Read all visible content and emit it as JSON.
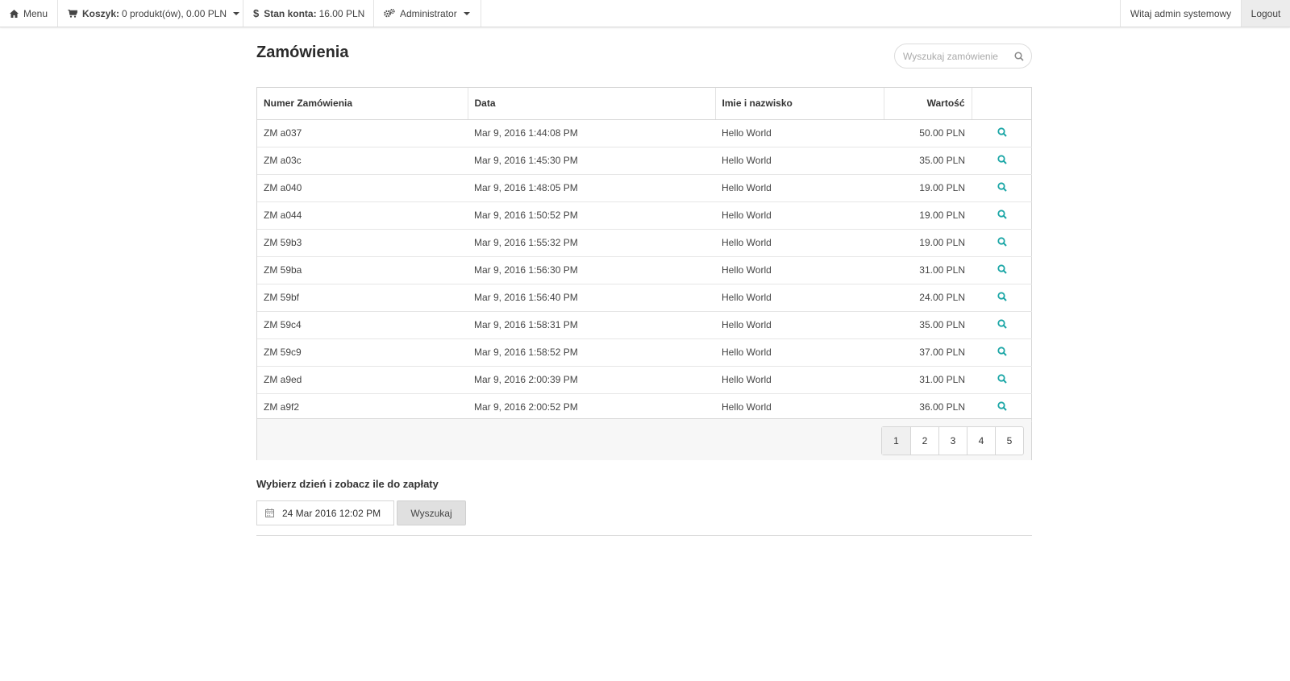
{
  "topbar": {
    "menu_label": "Menu",
    "cart_label": "Koszyk:",
    "cart_value": "0 produkt(ów), 0.00 PLN",
    "balance_label": "Stan konta:",
    "balance_value": "16.00 PLN",
    "admin_label": "Administrator",
    "welcome": "Witaj admin systemowy",
    "logout": "Logout"
  },
  "page": {
    "title": "Zamówienia",
    "search_placeholder": "Wyszukaj zamówienie"
  },
  "table": {
    "headers": [
      "Numer Zamówienia",
      "Data",
      "Imie i nazwisko",
      "Wartość"
    ],
    "rows": [
      [
        "ZM a037",
        "Mar 9, 2016 1:44:08 PM",
        "Hello World",
        "50.00 PLN"
      ],
      [
        "ZM a03c",
        "Mar 9, 2016 1:45:30 PM",
        "Hello World",
        "35.00 PLN"
      ],
      [
        "ZM a040",
        "Mar 9, 2016 1:48:05 PM",
        "Hello World",
        "19.00 PLN"
      ],
      [
        "ZM a044",
        "Mar 9, 2016 1:50:52 PM",
        "Hello World",
        "19.00 PLN"
      ],
      [
        "ZM 59b3",
        "Mar 9, 2016 1:55:32 PM",
        "Hello World",
        "19.00 PLN"
      ],
      [
        "ZM 59ba",
        "Mar 9, 2016 1:56:30 PM",
        "Hello World",
        "31.00 PLN"
      ],
      [
        "ZM 59bf",
        "Mar 9, 2016 1:56:40 PM",
        "Hello World",
        "24.00 PLN"
      ],
      [
        "ZM 59c4",
        "Mar 9, 2016 1:58:31 PM",
        "Hello World",
        "35.00 PLN"
      ],
      [
        "ZM 59c9",
        "Mar 9, 2016 1:58:52 PM",
        "Hello World",
        "37.00 PLN"
      ],
      [
        "ZM a9ed",
        "Mar 9, 2016 2:00:39 PM",
        "Hello World",
        "31.00 PLN"
      ],
      [
        "ZM a9f2",
        "Mar 9, 2016 2:00:52 PM",
        "Hello World",
        "36.00 PLN"
      ]
    ],
    "pages": [
      "1",
      "2",
      "3",
      "4",
      "5"
    ],
    "current_page": "1"
  },
  "payment": {
    "label": "Wybierz dzień i zobacz ile do zapłaty",
    "date_value": "24 Mar 2016 12:02 PM",
    "button": "Wyszukaj"
  },
  "colors": {
    "accent": "#1aa6a6",
    "topbar_border": "#d9d9d9",
    "logout_bg": "#ececec"
  },
  "icons": {
    "menu": "home-icon",
    "cart": "cart-icon",
    "balance": "dollar-icon",
    "admin": "cogs-icon",
    "row_action": "magnifier-icon",
    "date": "calendar-icon"
  }
}
